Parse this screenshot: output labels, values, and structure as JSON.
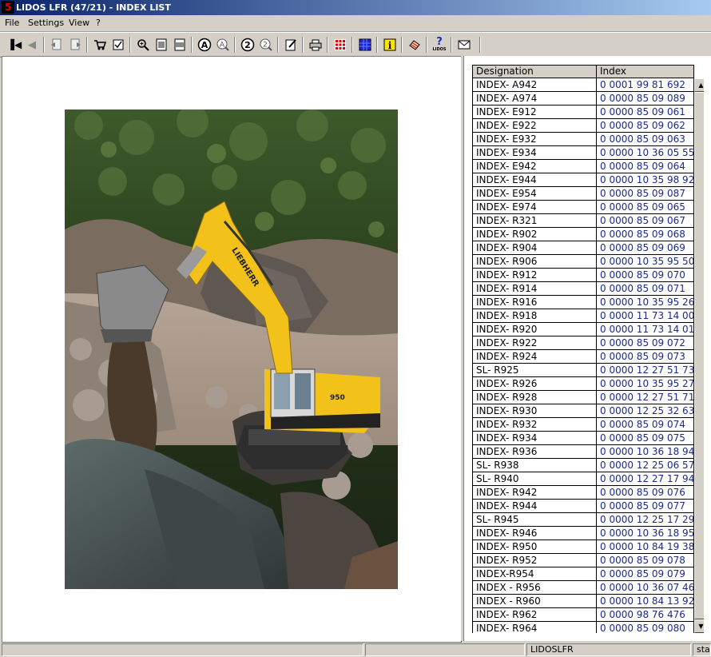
{
  "window": {
    "title": "LIDOS LFR (47/21) - INDEX LIST",
    "app_icon_text": "5"
  },
  "menu": [
    "File",
    "Settings",
    "View",
    "?"
  ],
  "toolbar": {
    "buttons": [
      {
        "name": "first-page-icon",
        "glyph": "⏮"
      },
      {
        "name": "prev-page-icon",
        "glyph": "◀"
      },
      {
        "name": "doc-back-icon",
        "glyph": "🗐"
      },
      {
        "name": "doc-forward-icon",
        "glyph": "🗐"
      },
      {
        "name": "cart-icon",
        "glyph": "🛒"
      },
      {
        "name": "checklist-icon",
        "glyph": "☑"
      },
      {
        "name": "zoom-in-icon",
        "glyph": "🔍"
      },
      {
        "name": "fit-page-icon",
        "glyph": "▣"
      },
      {
        "name": "fit-width-icon",
        "glyph": "▣"
      },
      {
        "name": "search-a-icon",
        "glyph": "Ⓐ"
      },
      {
        "name": "search-a-next-icon",
        "glyph": "Ⓐ"
      },
      {
        "name": "search-2-icon",
        "glyph": "②"
      },
      {
        "name": "search-2-next-icon",
        "glyph": "②"
      },
      {
        "name": "notes-icon",
        "glyph": "✎"
      },
      {
        "name": "print-icon",
        "glyph": "🖶"
      },
      {
        "name": "grid-red-icon",
        "glyph": "▦"
      },
      {
        "name": "grid-blue-icon",
        "glyph": "▦"
      },
      {
        "name": "info-icon",
        "glyph": "i"
      },
      {
        "name": "handshake-icon",
        "glyph": "✋"
      },
      {
        "name": "help-icon",
        "glyph": "?"
      },
      {
        "name": "mail-icon",
        "glyph": "✉"
      }
    ],
    "help_sublabel": "LIDOS"
  },
  "photo": {
    "brand_text": "LIEBHERR",
    "model_text": "950"
  },
  "index_list": {
    "columns": [
      "Designation",
      "Index"
    ],
    "rows": [
      [
        "INDEX- A942",
        "0 0001 99 81 692"
      ],
      [
        "INDEX- A974",
        "0 0000 85 09 089"
      ],
      [
        "INDEX- E912",
        "0 0000 85 09 061"
      ],
      [
        "INDEX- E922",
        "0 0000 85 09 062"
      ],
      [
        "INDEX- E932",
        "0 0000 85 09 063"
      ],
      [
        "INDEX- E934",
        "0 0000 10 36 05 55"
      ],
      [
        "INDEX- E942",
        "0 0000 85 09 064"
      ],
      [
        "INDEX- E944",
        "0 0000 10 35 98 92"
      ],
      [
        "INDEX- E954",
        "0 0000 85 09 087"
      ],
      [
        "INDEX- E974",
        "0 0000 85 09 065"
      ],
      [
        "INDEX- R321",
        "0 0000 85 09 067"
      ],
      [
        "INDEX- R902",
        "0 0000 85 09 068"
      ],
      [
        "INDEX- R904",
        "0 0000 85 09 069"
      ],
      [
        "INDEX- R906",
        "0 0000 10 35 95 50"
      ],
      [
        "INDEX- R912",
        "0 0000 85 09 070"
      ],
      [
        "INDEX- R914",
        "0 0000 85 09 071"
      ],
      [
        "INDEX- R916",
        "0 0000 10 35 95 26"
      ],
      [
        "INDEX- R918",
        "0 0000 11 73 14 00"
      ],
      [
        "INDEX- R920",
        "0 0000 11 73 14 01"
      ],
      [
        "INDEX- R922",
        "0 0000 85 09 072"
      ],
      [
        "INDEX- R924",
        "0 0000 85 09 073"
      ],
      [
        "SL- R925",
        "0 0000 12 27 51 73"
      ],
      [
        "INDEX- R926",
        "0 0000 10 35 95 27"
      ],
      [
        "INDEX- R928",
        "0 0000 12 27 51 71"
      ],
      [
        "INDEX- R930",
        "0 0000 12 25 32 63"
      ],
      [
        "INDEX- R932",
        "0 0000 85 09 074"
      ],
      [
        "INDEX- R934",
        "0 0000 85 09 075"
      ],
      [
        "INDEX- R936",
        "0 0000 10 36 18 94"
      ],
      [
        "SL- R938",
        "0 0000 12 25 06 57"
      ],
      [
        "SL- R940",
        "0 0000 12 27 17 94"
      ],
      [
        "INDEX- R942",
        "0 0000 85 09 076"
      ],
      [
        "INDEX- R944",
        "0 0000 85 09 077"
      ],
      [
        "SL- R945",
        "0 0000 12 25 17 29"
      ],
      [
        "INDEX- R946",
        "0 0000 10 36 18 95"
      ],
      [
        "INDEX- R950",
        "0 0000 10 84 19 38"
      ],
      [
        "INDEX- R952",
        "0 0000 85 09 078"
      ],
      [
        "INDEX-R954",
        "0 0000 85 09 079"
      ],
      [
        "INDEX - R956",
        "0 0000 10 36 07 46"
      ],
      [
        "INDEX - R960",
        "0 0000 10 84 13 92"
      ],
      [
        "INDEX- R962",
        "0 0000 98 76 476"
      ],
      [
        "INDEX- R964",
        "0 0000 85 09 080"
      ]
    ]
  },
  "statusbar": {
    "panels": [
      "",
      "",
      "LIDOSLFR",
      "star"
    ]
  },
  "colors": {
    "title_start": "#0a246a",
    "title_end": "#a6caf0",
    "index_text": "#1a2a8a",
    "machine_yellow": "#f2c21a"
  }
}
